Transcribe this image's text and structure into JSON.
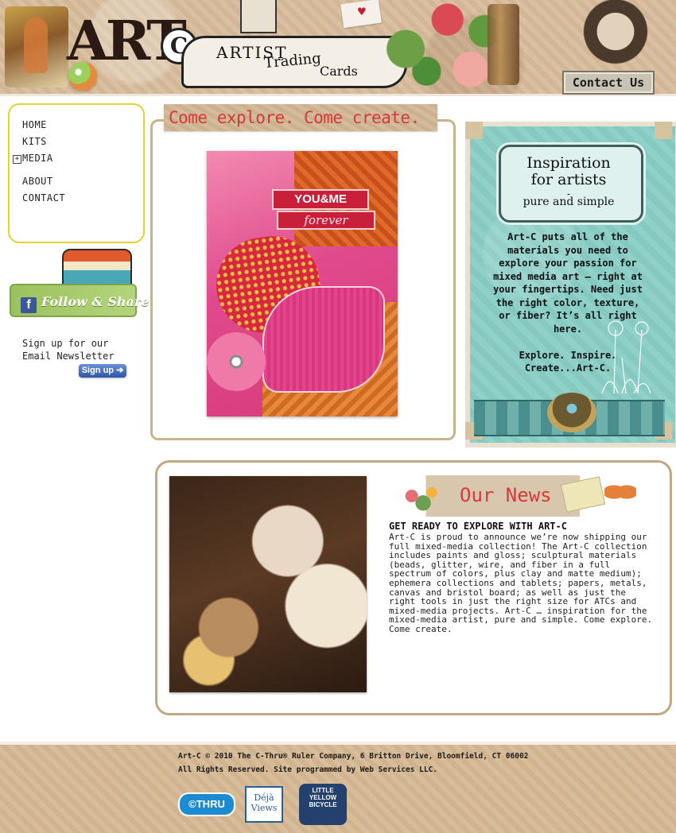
{
  "header": {
    "logo_art": "ART",
    "logo_c": "C",
    "banner_line1": "ARTIST",
    "banner_line2": "Trading",
    "banner_line3": "Cards",
    "contact_label": "Contact Us"
  },
  "nav": {
    "items": [
      {
        "label": "HOME"
      },
      {
        "label": "KITS"
      },
      {
        "label": "MEDIA"
      },
      {
        "label": "ABOUT"
      },
      {
        "label": "CONTACT"
      }
    ],
    "media_expander": "+"
  },
  "social": {
    "facebook_glyph": "f",
    "follow_label": "Follow & Share"
  },
  "newsletter": {
    "text": "Sign up for our\nEmail Newsletter",
    "button_label": "Sign up ➔"
  },
  "feature": {
    "banner": "Come explore. Come create.",
    "card_label1": "YOU&ME",
    "card_label2": "forever"
  },
  "inspiration": {
    "title": "Inspiration\nfor artists",
    "dash": "-",
    "subtitle": "pure and simple",
    "body": "Art-C puts all of the\nmaterials you need to\nexplore your passion for\nmixed media art – right at\nyour fingertips. Need just\nthe right color, texture,\nor fiber? It’s all right\nhere.\n\nExplore. Inspire.\nCreate...Art-C."
  },
  "news": {
    "banner_title": "Our News",
    "headline": "GET READY TO EXPLORE WITH ART-C",
    "body": "Art-C is proud to announce we’re now shipping our\nfull mixed-media collection! The Art-C collection\nincludes paints and gloss; sculptural materials\n(beads, glitter, wire, and fiber in a full\nspectrum of colors, plus clay and matte medium);\nephemera collections and tablets; papers, metals,\ncanvas and bristol board; as well as just the\nright tools in just the right size for ATCs and\nmixed-media projects. Art-C … inspiration for the\nmixed-media artist, pure and simple. Come explore.\nCome create."
  },
  "footer": {
    "line1": "Art-C © 2010 The C-Thru® Ruler Company, 6 Britton Drive, Bloomfield, CT 06002",
    "line2": "All Rights Reserved. Site programmed by Web Services LLC.",
    "logos": {
      "cthru": "©THRU",
      "dejaviews": "Déjà\nViews",
      "bicycle": "LITTLE\nYELLOW\nBICYCLE"
    }
  },
  "colors": {
    "accent_red": "#d33a3a",
    "nav_border": "#e2d23a",
    "teal_panel": "#8fd0c8",
    "signup_blue": "#2f56a6"
  }
}
